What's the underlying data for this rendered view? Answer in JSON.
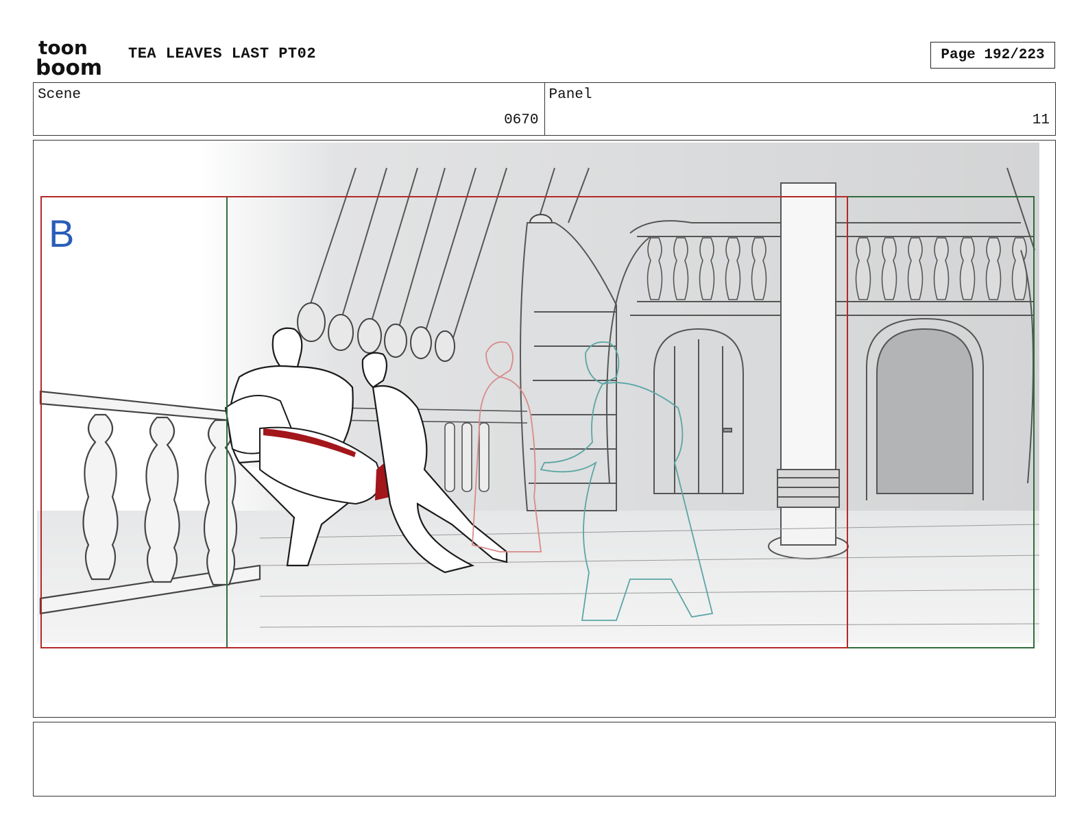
{
  "header": {
    "logo_text_top": "toon",
    "logo_text_bottom": "boom",
    "title": "TEA LEAVES LAST PT02",
    "page": "Page 192/223"
  },
  "info": {
    "scene_label": "Scene",
    "scene_value": "0670",
    "panel_label": "Panel",
    "panel_value": "11"
  },
  "panel": {
    "layer_marker": "B",
    "colors": {
      "frame_red": "#b32828",
      "frame_green": "#2f6b3c",
      "marker_blue": "#2a5db8",
      "blood": "#a3161a",
      "ghost_teal": "#5aa5a5",
      "ghost_red": "#d88a8a",
      "sketch": "#222222",
      "bg_gray": "#d6d7d8"
    }
  },
  "notes": {
    "text": ""
  }
}
